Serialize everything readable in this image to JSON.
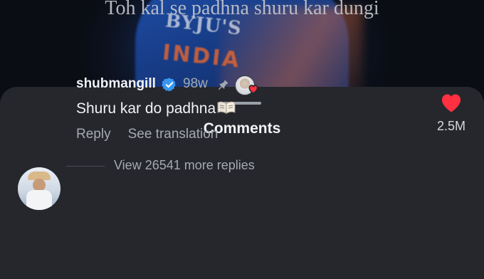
{
  "video": {
    "caption": "Toh kal se padhna shuru kar dungi",
    "jersey_brand": "BYJU'S",
    "jersey_country": "INDIA"
  },
  "sheet": {
    "title": "Comments"
  },
  "comment": {
    "username": "shubmangill",
    "age": "98w",
    "text": "Shuru kar do padhna",
    "reply_label": "Reply",
    "translate_label": "See translation",
    "like_count": "2.5M",
    "more_replies": "View 26541 more replies"
  },
  "icons": {
    "verified": "verified-badge-icon",
    "pin": "pin-icon",
    "creator_like": "creator-liked-icon",
    "book": "open-book-icon",
    "like": "heart-icon"
  },
  "colors": {
    "sheet_bg": "#25272d",
    "like_red": "#ff3040",
    "verified_blue": "#3897f0"
  }
}
